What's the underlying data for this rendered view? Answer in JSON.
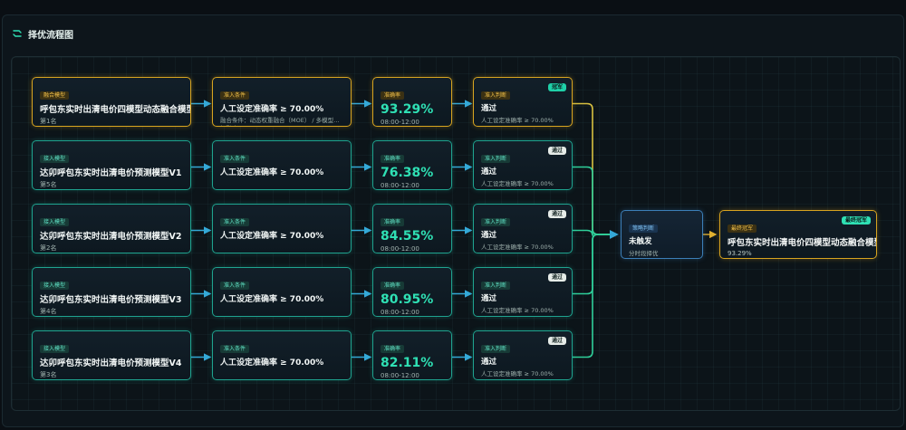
{
  "header": {
    "title": "择优流程图",
    "icon": "flow-icon"
  },
  "rows": [
    {
      "model": {
        "tag": "融合模型",
        "name": "呼包东实时出清电价四模型动态融合模型",
        "rank": "第1名",
        "highlight": true
      },
      "condition": {
        "tag": "准入条件",
        "main": "人工设定准确率 ≥ 70.00%",
        "sub": "融合条件：动态权重融合（MOE） / 多模型…权融合"
      },
      "accuracy": {
        "tag": "准确率",
        "value": "93.29%",
        "time": "08:00-12:00"
      },
      "judge": {
        "tag": "准入判断",
        "badge": "冠军",
        "main": "通过",
        "sub": "人工设定准确率 ≥ 70.00%"
      }
    },
    {
      "model": {
        "tag": "接入模型",
        "name": "达卯呼包东实时出清电价预测模型V1",
        "rank": "第5名",
        "highlight": false
      },
      "condition": {
        "tag": "准入条件",
        "main": "人工设定准确率 ≥ 70.00%",
        "sub": ""
      },
      "accuracy": {
        "tag": "准确率",
        "value": "76.38%",
        "time": "08:00-12:00"
      },
      "judge": {
        "tag": "准入判断",
        "badge": "通过",
        "main": "通过",
        "sub": "人工设定准确率 ≥ 70.00%"
      }
    },
    {
      "model": {
        "tag": "接入模型",
        "name": "达卯呼包东实时出清电价预测模型V2",
        "rank": "第2名",
        "highlight": false
      },
      "condition": {
        "tag": "准入条件",
        "main": "人工设定准确率 ≥ 70.00%",
        "sub": ""
      },
      "accuracy": {
        "tag": "准确率",
        "value": "84.55%",
        "time": "08:00-12:00"
      },
      "judge": {
        "tag": "准入判断",
        "badge": "通过",
        "main": "通过",
        "sub": "人工设定准确率 ≥ 70.00%"
      }
    },
    {
      "model": {
        "tag": "接入模型",
        "name": "达卯呼包东实时出清电价预测模型V3",
        "rank": "第4名",
        "highlight": false
      },
      "condition": {
        "tag": "准入条件",
        "main": "人工设定准确率 ≥ 70.00%",
        "sub": ""
      },
      "accuracy": {
        "tag": "准确率",
        "value": "80.95%",
        "time": "08:00-12:00"
      },
      "judge": {
        "tag": "准入判断",
        "badge": "通过",
        "main": "通过",
        "sub": "人工设定准确率 ≥ 70.00%"
      }
    },
    {
      "model": {
        "tag": "接入模型",
        "name": "达卯呼包东实时出清电价预测模型V4",
        "rank": "第3名",
        "highlight": false
      },
      "condition": {
        "tag": "准入条件",
        "main": "人工设定准确率 ≥ 70.00%",
        "sub": ""
      },
      "accuracy": {
        "tag": "准确率",
        "value": "82.11%",
        "time": "08:00-12:00"
      },
      "judge": {
        "tag": "准入判断",
        "badge": "通过",
        "main": "通过",
        "sub": "人工设定准确率 ≥ 70.00%"
      }
    }
  ],
  "strategy": {
    "tag": "策略判断",
    "main": "未触发",
    "sub": "分时段择优"
  },
  "final": {
    "tag": "最终冠军",
    "badge": "最终冠军",
    "name": "呼包东实时出清电价四模型动态融合模型",
    "accuracy": "93.29%"
  },
  "colors": {
    "accent": "#2fe0b4",
    "gold": "#d8a420",
    "blue": "#3c7fb8",
    "background": "#0a0f14"
  }
}
